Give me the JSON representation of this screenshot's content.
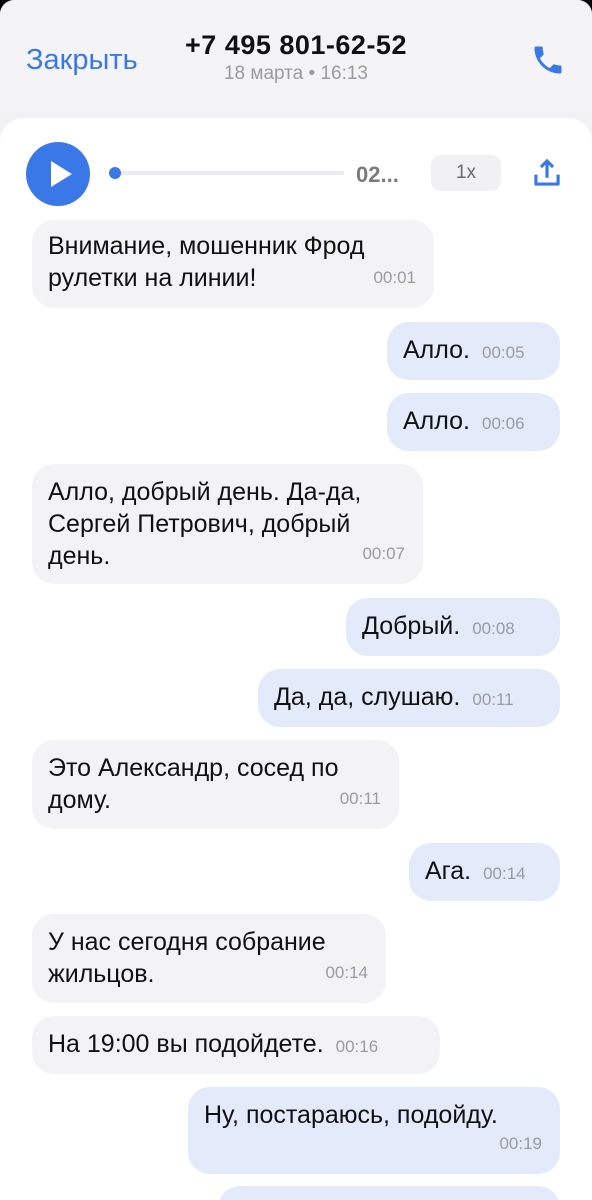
{
  "header": {
    "close_label": "Закрыть",
    "phone_number": "+7 495 801-62-52",
    "date_time": "18 марта • 16:13",
    "call_icon": "phone-icon"
  },
  "player": {
    "play_icon": "play-icon",
    "progress": 0,
    "duration_text": "02...",
    "speed_label": "1x",
    "share_icon": "share-icon"
  },
  "colors": {
    "accent": "#3b78e7",
    "incoming_bubble": "#f3f3f5",
    "outgoing_bubble": "#e3ebfb",
    "time_text": "#9b9ba3"
  },
  "messages": [
    {
      "side": "in",
      "text": "Внимание, мошенник Фрод рулетки на линии!",
      "time": "00:01"
    },
    {
      "side": "out",
      "text": "Алло.",
      "time": "00:05"
    },
    {
      "side": "out",
      "text": "Алло.",
      "time": "00:06"
    },
    {
      "side": "in",
      "text": "Алло, добрый день. Да-да, Сергей Петрович, добрый день.",
      "time": "00:07"
    },
    {
      "side": "out",
      "text": "Добрый.",
      "time": "00:08"
    },
    {
      "side": "out",
      "text": "Да, да, слушаю.",
      "time": "00:11"
    },
    {
      "side": "in",
      "text": "Это Александр, сосед по дому.",
      "time": "00:11"
    },
    {
      "side": "out",
      "text": "Ага.",
      "time": "00:14"
    },
    {
      "side": "in",
      "text": "У нас сегодня собрание жильцов.",
      "time": "00:14"
    },
    {
      "side": "in",
      "text": "На 19:00 вы подойдете.",
      "time": "00:16"
    },
    {
      "side": "out",
      "text": "Ну, постараюсь, подойду.",
      "time": "00:19"
    }
  ]
}
